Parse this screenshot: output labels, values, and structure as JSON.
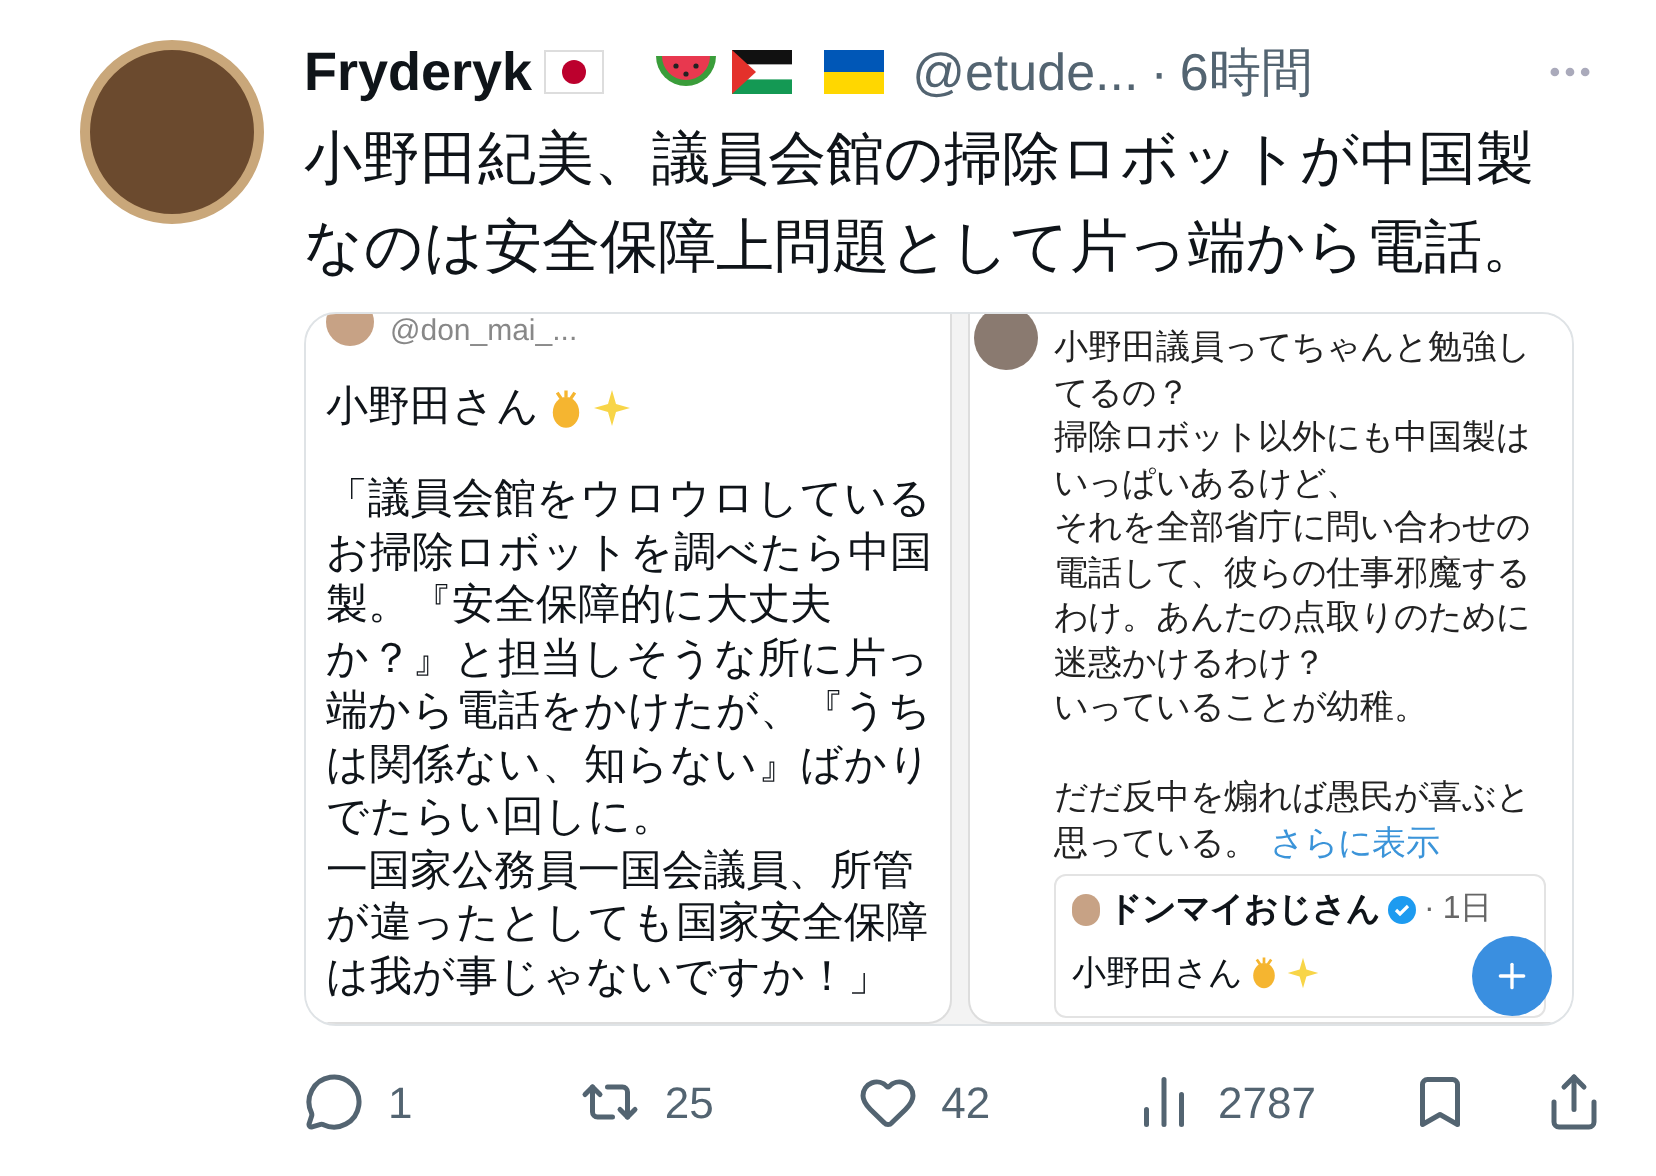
{
  "post": {
    "author": "Fryderyk",
    "handle": "@etude...",
    "separator": "·",
    "time": "6時間",
    "text": "小野田紀美、議員会館の掃除ロボットが中国製なのは安全保障上問題として片っ端から電話。"
  },
  "image": {
    "left": {
      "handle": "@don_mai_...",
      "greeting": "小野田さん",
      "paragraphs": [
        "「議員会館をウロウロしているお掃除ロボットを調べたら中国製。『安全保障的に大丈夫か？』と担当しそうな所に片っ端から電話をかけたが、『うちは関係ない、知らない』ばかりでたらい回しに。",
        "一国家公務員一国会議員、所管が違ったとしても国家安全保障は我が事じゃないですか！」"
      ]
    },
    "right": {
      "blocks": [
        [
          "小野田議員ってちゃんと勉強してるの？",
          "掃除ロボット以外にも中国製はいっぱいあるけど、",
          "それを全部省庁に問い合わせの電話して、彼らの仕事邪魔するわけ。あんたの点取りのために迷惑かけるわけ？",
          "いっていることが幼稚。"
        ],
        [
          "だだ反中を煽れば愚民が喜ぶと思っている。"
        ]
      ],
      "more_link": "さらに表示",
      "quote": {
        "name": "ドンマイおじさん",
        "separator": "·",
        "time": "1日",
        "text": "小野田さん"
      }
    }
  },
  "actions": [
    {
      "kind": "reply",
      "count": "1"
    },
    {
      "kind": "retweet",
      "count": "25"
    },
    {
      "kind": "like",
      "count": "42"
    },
    {
      "kind": "views",
      "count": "2787"
    },
    {
      "kind": "bookmark"
    },
    {
      "kind": "share"
    }
  ]
}
